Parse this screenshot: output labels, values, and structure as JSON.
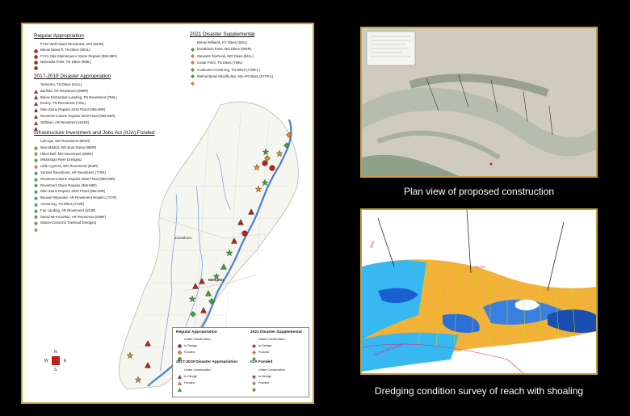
{
  "captions": {
    "plan": "Plan view of proposed construction",
    "survey": "Dredging condition survey of reach with shoaling"
  },
  "map": {
    "city_labels": [
      "Jonesboro",
      "Memphis"
    ],
    "compass": {
      "n": "N",
      "w": "W",
      "e": "E",
      "s": "S"
    },
    "regular": {
      "title": "Regular Appropriation",
      "items": [
        "FY22 Wolf Island Revetment, MO (934R)",
        "Below Island 9, TN Dikes (901L)",
        "FY21 Dike Maintenance Stone Repairs (955-59R)",
        "Nebraska Point, TN Dikes (908L)"
      ]
    },
    "disaster1719": {
      "title": "2017-2019 Disaster Appropriation",
      "items": [
        "Tennemo, TN Dikes (841L)",
        "Barfield, AR Revetment (808R)",
        "Below Richardson Landing, TN Revetment (769L)",
        "Ensley, TN Revetment (723L)",
        "Dike Stone Repairs 2019 Flood (955-59R)",
        "Revetment Stone Repairs 2019 Flood (955-59R)",
        "Oldtown, AR Revetment (644R)"
      ]
    },
    "disaster2021": {
      "title": "2021 Disaster Supplemental",
      "items": [
        "Below Williams, KY Dikes (926L)",
        "Donaldson Point, MO Dikes (905R)",
        "Stewarts Towhead, MO Dikes (841L)",
        "Cedar Point, TN Dikes (759L)",
        "Coahoma-Armstrong, TN Dikes (719R-L)",
        "Walnut Bend-Shoofly Bar, MS-AR Dikes (677R-L)"
      ]
    },
    "iija": {
      "title": "Infrastructure Investment and Jobs Act (IIJA) Funded",
      "items": [
        "LaForge, MO Revetment (891R)",
        "New Madrid, MO Boat Ramp (889R)",
        "Hilton Bell, MO Revetment (908R)",
        "Mississippi River Dredging",
        "Little Cypress, MO Revetment (863R)",
        "Sunrise Revetment, AR Revetment (775R)",
        "Revetment Stone Repairs 2020 Flood (955-59R)",
        "Revetment Stone Repairs (955-59R)",
        "Dike Stone Repairs 2020 Flood (955-59R)",
        "Beuvoir-Wyanoke, AR Revetment Repairs (727R)",
        "Armstrong, TN Dikes (719R)",
        "Fair Landing, AR Revetment (633R)",
        "Island 68-Knowlton, AR Revetment (639R)",
        "Mason-Cessions Towhead Dredging"
      ]
    },
    "legend_box": {
      "regular_title": "Regular Appropriation",
      "regular_items": [
        "Under Construction",
        "In Design",
        "Funded"
      ],
      "d1719_title": "2017-2019 Disaster Appropriation",
      "d1719_items": [
        "Under Construction",
        "In Design",
        "Funded"
      ],
      "d2021_title": "2021 Disaster Supplemental",
      "d2021_items": [
        "Under Construction",
        "In Design",
        "Funded"
      ],
      "iija_title": "IIJA Funded",
      "iija_items": [
        "Under Construction",
        "In Design",
        "Funded"
      ]
    },
    "colors": {
      "under_construction": "#c0201c",
      "in_design": "#e08a1e",
      "funded": "#3da63a",
      "river": "#4a7fd0",
      "frame": "#c8a032"
    }
  },
  "survey": {
    "labels": [
      "DIKE",
      "RIVER",
      "ISLAND NO 8 DIKES"
    ]
  }
}
